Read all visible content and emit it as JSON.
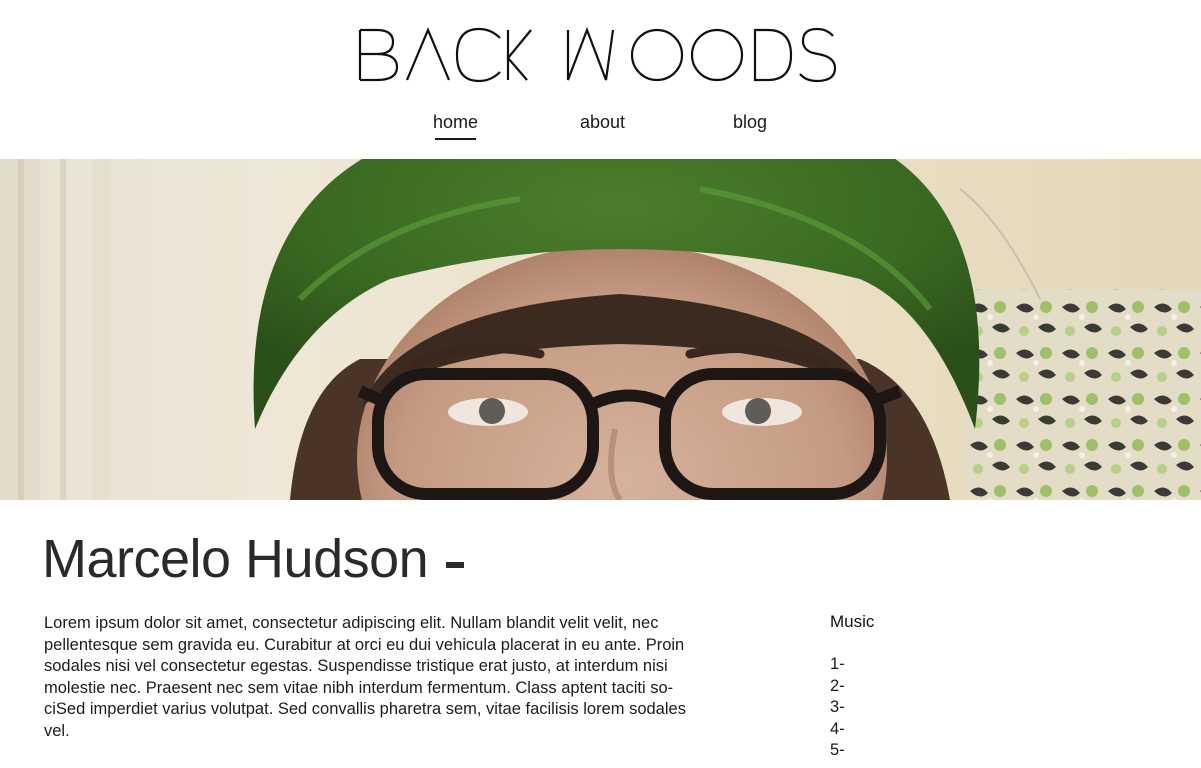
{
  "header": {
    "logo_text": "BACK WOODS"
  },
  "nav": {
    "items": [
      {
        "label": "home",
        "active": true
      },
      {
        "label": "about",
        "active": false
      },
      {
        "label": "blog",
        "active": false
      }
    ]
  },
  "hero": {
    "image_description_icon": "portrait-photo"
  },
  "profile": {
    "name": "Marcelo Hudson",
    "bio_lines": [
      "Lorem ipsum dolor sit amet, consectetur adipiscing elit. Nullam blandit velit velit, nec",
      "pellentesque sem gravida eu. Curabitur at orci eu dui vehicula placerat in eu ante. Proin",
      "sodales nisi vel consectetur egestas. Suspendisse tristique erat justo, at interdum nisi",
      "molestie nec. Praesent nec sem vitae nibh interdum fermentum. Class aptent taciti so-",
      "ciSed imperdiet varius volutpat. Sed convallis pharetra sem, vitae facilisis lorem sodales",
      "vel."
    ]
  },
  "sidebar": {
    "music_title": "Music",
    "music_items": [
      "1-",
      "2-",
      "3-",
      "4-",
      "5-"
    ]
  }
}
